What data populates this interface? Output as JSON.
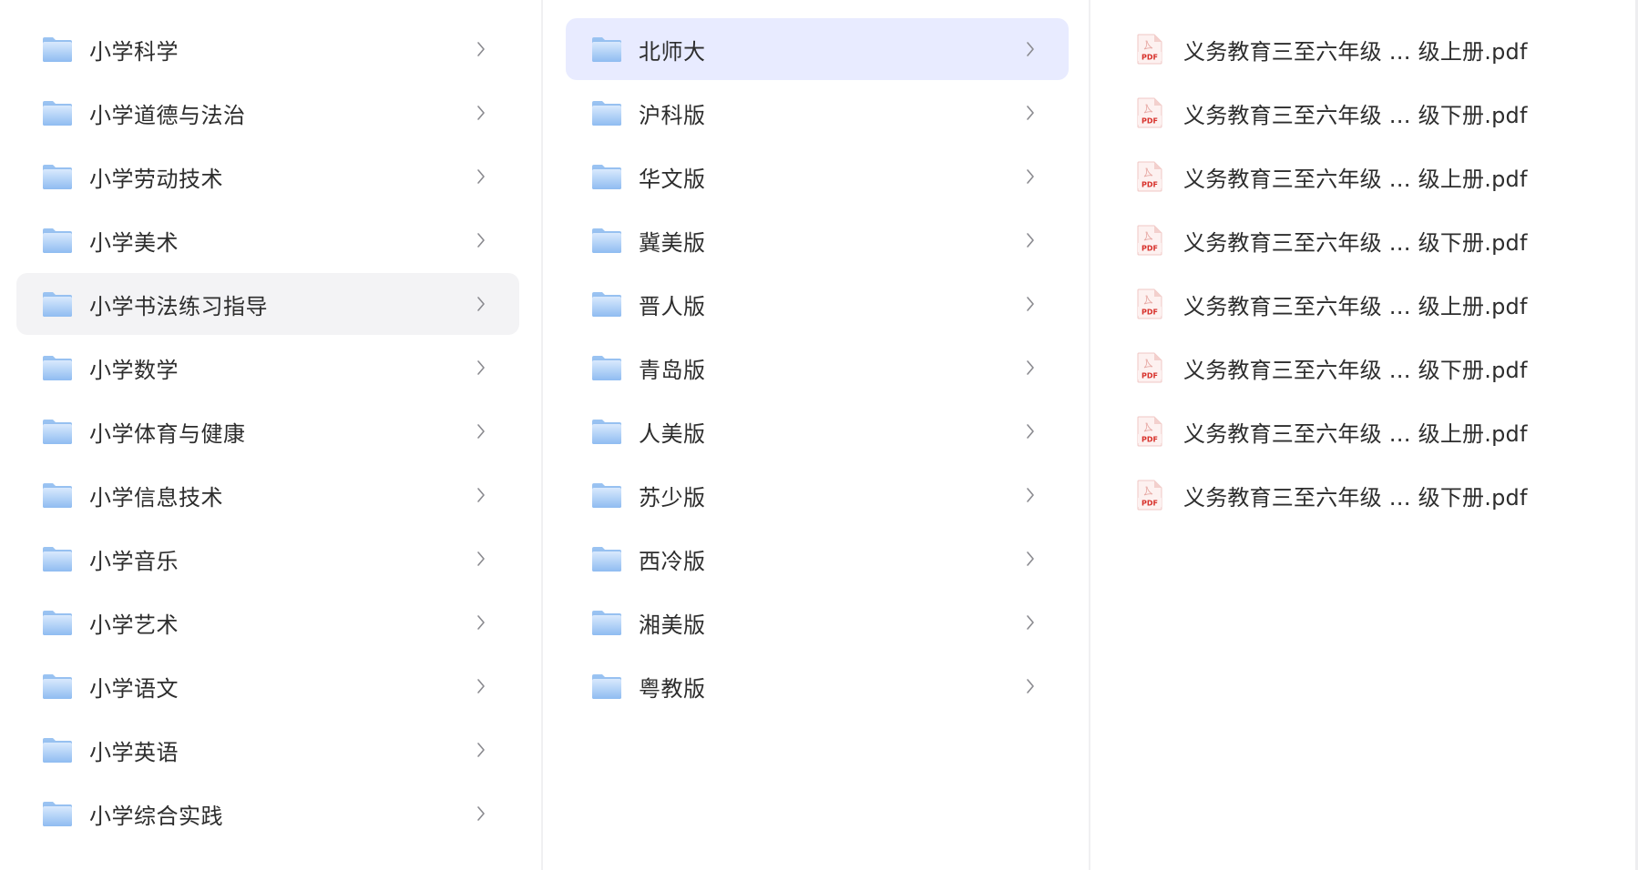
{
  "column1": {
    "items": [
      {
        "label": "小学科学"
      },
      {
        "label": "小学道德与法治"
      },
      {
        "label": "小学劳动技术"
      },
      {
        "label": "小学美术"
      },
      {
        "label": "小学书法练习指导"
      },
      {
        "label": "小学数学"
      },
      {
        "label": "小学体育与健康"
      },
      {
        "label": "小学信息技术"
      },
      {
        "label": "小学音乐"
      },
      {
        "label": "小学艺术"
      },
      {
        "label": "小学语文"
      },
      {
        "label": "小学英语"
      },
      {
        "label": "小学综合实践"
      }
    ],
    "hovered_label": "小学书法练习指导"
  },
  "column2": {
    "items": [
      {
        "label": "北师大"
      },
      {
        "label": "沪科版"
      },
      {
        "label": "华文版"
      },
      {
        "label": "冀美版"
      },
      {
        "label": "晋人版"
      },
      {
        "label": "青岛版"
      },
      {
        "label": "人美版"
      },
      {
        "label": "苏少版"
      },
      {
        "label": "西冷版"
      },
      {
        "label": "湘美版"
      },
      {
        "label": "粤教版"
      }
    ],
    "selected_label": "北师大"
  },
  "column3": {
    "items": [
      {
        "label": "义务教育三至六年级 … 级上册.pdf"
      },
      {
        "label": "义务教育三至六年级 … 级下册.pdf"
      },
      {
        "label": "义务教育三至六年级 … 级上册.pdf"
      },
      {
        "label": "义务教育三至六年级 … 级下册.pdf"
      },
      {
        "label": "义务教育三至六年级 … 级上册.pdf"
      },
      {
        "label": "义务教育三至六年级 … 级下册.pdf"
      },
      {
        "label": "义务教育三至六年级 … 级上册.pdf"
      },
      {
        "label": "义务教育三至六年级 … 级下册.pdf"
      }
    ]
  },
  "icons": {
    "folder": "folder-icon",
    "file": "pdf-file-icon",
    "chevron": "chevron-right-icon",
    "pdf_badge_text": "PDF"
  },
  "colors": {
    "folder_light": "#cfe2fb",
    "folder_dark": "#7fb1ee",
    "pdf_red": "#d7302a",
    "hover_bg": "#f3f3f5",
    "selected_bg": "#e8ebff"
  }
}
